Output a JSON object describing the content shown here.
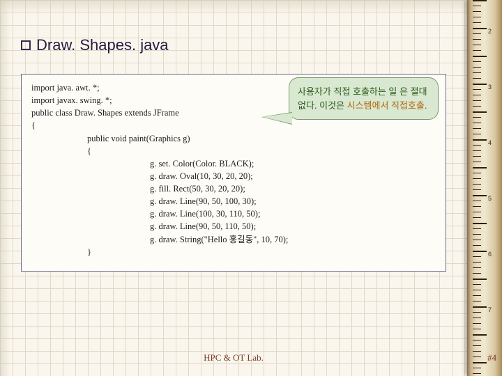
{
  "title": "Draw. Shapes. java",
  "code": {
    "l1": "import java. awt. *;",
    "l2": "import javax. swing. *;",
    "l3": "public class Draw. Shapes extends JFrame",
    "l4": "{",
    "l5": "public void paint(Graphics g)",
    "l6": "{",
    "l7": "g. set. Color(Color. BLACK);",
    "l8": "g. draw. Oval(10, 30, 20, 20);",
    "l9": "g. fill. Rect(50, 30, 20, 20);",
    "l10": "g. draw. Line(90, 50, 100, 30);",
    "l11": "g. draw. Line(100, 30, 110, 50);",
    "l12": "g. draw. Line(90, 50, 110, 50);",
    "l13": "g. draw. String(\"Hello 홍길동\", 10, 70);",
    "l14": "}"
  },
  "callout": {
    "line1": "사용자가 직접 호출하는 일",
    "line2a": "은 절대 없다. 이것은 ",
    "line2b": "시스템에서 직접호출",
    "line2c": "."
  },
  "footer": "HPC & OT Lab.",
  "page": "#4",
  "ruler_numbers": [
    "2",
    "3",
    "4",
    "5",
    "6",
    "7"
  ]
}
